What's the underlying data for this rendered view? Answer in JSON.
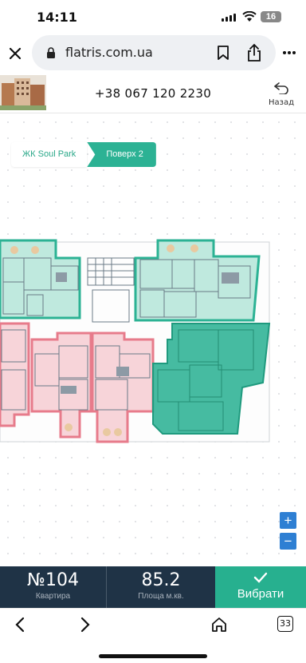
{
  "status": {
    "time": "14:11",
    "battery": "16"
  },
  "browser": {
    "url": "flatris.com.ua",
    "tabs_count": "33"
  },
  "header": {
    "phone": "+38 067 120 2230",
    "back_label": "Назад"
  },
  "breadcrumbs": [
    {
      "label": "ЖК Soul Park"
    },
    {
      "label": "Поверх 2"
    }
  ],
  "plan": {
    "selected_color": "#2cb294",
    "sold_color": "#e77b8b"
  },
  "zoom": {
    "in": "+",
    "out": "−"
  },
  "summary": {
    "apartment_number": "№104",
    "apartment_caption": "Квартира",
    "area": "85.2",
    "area_caption": "Площа м.кв.",
    "select_label": "Вибрати"
  },
  "colors": {
    "accent": "#2cb294",
    "dark": "#1f3346",
    "zoom": "#2e7fd3"
  }
}
